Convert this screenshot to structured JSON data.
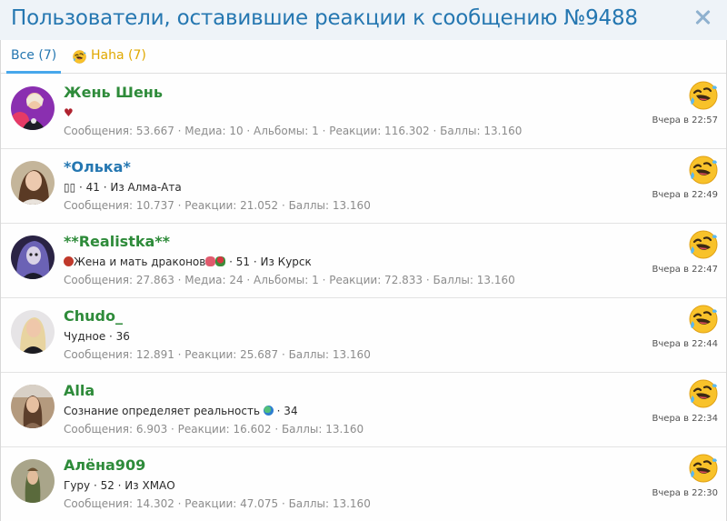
{
  "dialog": {
    "title": "Пользователи, оставившие реакции к сообщению №9488"
  },
  "tabs": {
    "all_label": "Все (7)",
    "haha_label": "Haha (7)"
  },
  "users": [
    {
      "name": "Жень Шень",
      "name_color": "#2e8b3a",
      "subline": "♥",
      "stats": "Сообщения: 53.667 · Медиа: 10 · Альбомы: 1 · Реакции: 116.302 · Баллы: 13.160",
      "reaction": "haha-icon",
      "time": "Вчера в 22:57"
    },
    {
      "name": "*Олька*",
      "name_color": "#2577b1",
      "subline": "▯▯ · 41 · Из Алма-Ата",
      "stats": "Сообщения: 10.737 · Реакции: 21.052 · Баллы: 13.160",
      "reaction": "haha-icon",
      "time": "Вчера в 22:49"
    },
    {
      "name": "**Realistka**",
      "name_color": "#2e8b3a",
      "subline": "Жена и мать драконов",
      "subline_tail": " · 51 · Из Курск",
      "stats": "Сообщения: 27.863 · Медиа: 24 · Альбомы: 1 · Реакции: 72.833 · Баллы: 13.160",
      "reaction": "haha-icon",
      "time": "Вчера в 22:47"
    },
    {
      "name": "Chudo_",
      "name_color": "#2e8b3a",
      "subline": "Чудное · 36",
      "stats": "Сообщения: 12.891 · Реакции: 25.687 · Баллы: 13.160",
      "reaction": "haha-icon",
      "time": "Вчера в 22:44"
    },
    {
      "name": "Alla",
      "name_color": "#2e8b3a",
      "subline": "Сознание определяет реальность",
      "subline_tail": " · 34",
      "stats": "Сообщения: 6.903 · Реакции: 16.602 · Баллы: 13.160",
      "reaction": "haha-icon",
      "time": "Вчера в 22:34"
    },
    {
      "name": "Алёна909",
      "name_color": "#2e8b3a",
      "subline": "Гуру · 52 · Из ХМАО",
      "stats": "Сообщения: 14.302 · Реакции: 47.075 · Баллы: 13.160",
      "reaction": "haha-icon",
      "time": "Вчера в 22:30"
    }
  ],
  "colors": {
    "title": "#2577b1",
    "accent": "#47a7eb",
    "haha_tab": "#e0a800",
    "username_green": "#2e8b3a",
    "username_blue": "#2577b1"
  }
}
